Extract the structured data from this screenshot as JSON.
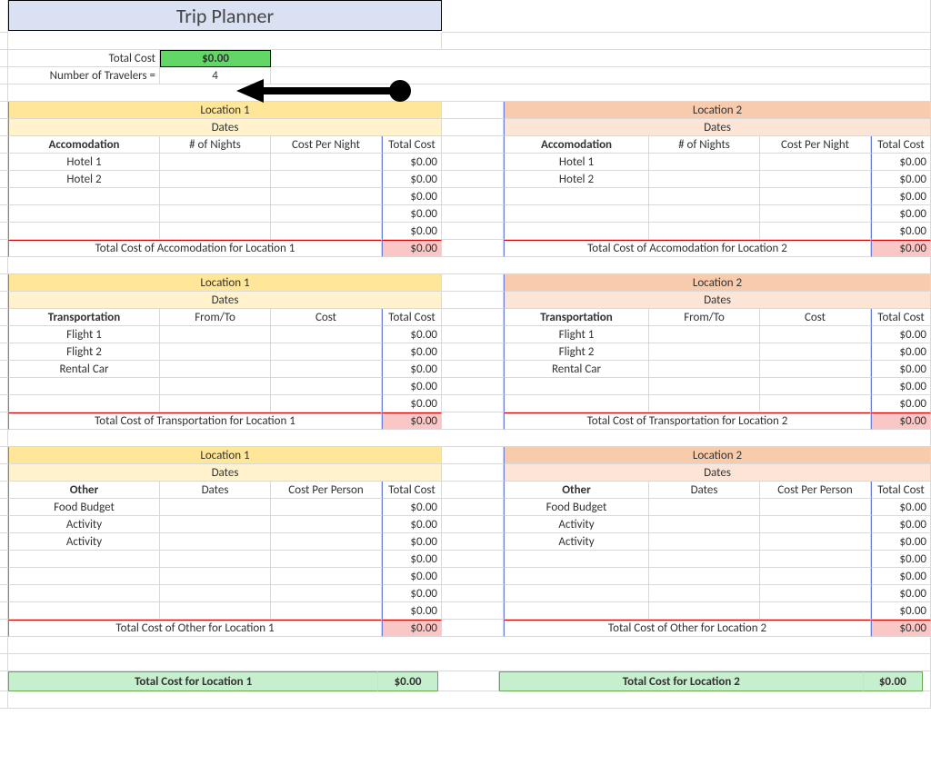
{
  "title": "Trip Planner",
  "summary": {
    "totalCostLabel": "Total Cost",
    "totalCostValue": "$0.00",
    "travelersLabel": "Number of Travelers  =",
    "travelersValue": "4"
  },
  "sections": {
    "accom": {
      "left": {
        "locHeader": "Location 1",
        "datesHeader": "Dates",
        "colA": "Accomodation",
        "colB": "# of Nights",
        "colC": "Cost Per Night",
        "colD": "Total Cost",
        "rows": [
          "Hotel 1",
          "Hotel 2",
          "",
          "",
          ""
        ],
        "vals": [
          "$0.00",
          "$0.00",
          "$0.00",
          "$0.00",
          "$0.00"
        ],
        "sumLabel": "Total Cost of Accomodation for Location 1",
        "sumVal": "$0.00"
      },
      "right": {
        "locHeader": "Location 2",
        "datesHeader": "Dates",
        "colA": "Accomodation",
        "colB": "# of Nights",
        "colC": "Cost Per Night",
        "colD": "Total Cost",
        "rows": [
          "Hotel 1",
          "Hotel 2",
          "",
          "",
          ""
        ],
        "vals": [
          "$0.00",
          "$0.00",
          "$0.00",
          "$0.00",
          "$0.00"
        ],
        "sumLabel": "Total Cost of Accomodation for Location 2",
        "sumVal": "$0.00"
      }
    },
    "transport": {
      "left": {
        "locHeader": "Location 1",
        "datesHeader": "Dates",
        "colA": "Transportation",
        "colB": "From/To",
        "colC": "Cost",
        "colD": "Total Cost",
        "rows": [
          "Flight 1",
          "Flight 2",
          "Rental Car",
          "",
          ""
        ],
        "vals": [
          "$0.00",
          "$0.00",
          "$0.00",
          "$0.00",
          "$0.00"
        ],
        "sumLabel": "Total Cost of Transportation for Location 1",
        "sumVal": "$0.00"
      },
      "right": {
        "locHeader": "Location 2",
        "datesHeader": "Dates",
        "colA": "Transportation",
        "colB": "From/To",
        "colC": "Cost",
        "colD": "Total Cost",
        "rows": [
          "Flight 1",
          "Flight 2",
          "Rental Car",
          "",
          ""
        ],
        "vals": [
          "$0.00",
          "$0.00",
          "$0.00",
          "$0.00",
          "$0.00"
        ],
        "sumLabel": "Total Cost of Transportation for Location 2",
        "sumVal": "$0.00"
      }
    },
    "other": {
      "left": {
        "locHeader": "Location 1",
        "datesHeader": "Dates",
        "colA": "Other",
        "colB": "Dates",
        "colC": "Cost Per Person",
        "colD": "Total Cost",
        "rows": [
          "Food Budget",
          "Activity",
          "Activity",
          "",
          "",
          "",
          ""
        ],
        "vals": [
          "$0.00",
          "$0.00",
          "$0.00",
          "$0.00",
          "$0.00",
          "$0.00",
          "$0.00"
        ],
        "sumLabel": "Total Cost of Other for Location 1",
        "sumVal": "$0.00"
      },
      "right": {
        "locHeader": "Location 2",
        "datesHeader": "Dates",
        "colA": "Other",
        "colB": "Dates",
        "colC": "Cost Per Person",
        "colD": "Total Cost",
        "rows": [
          "Food Budget",
          "Activity",
          "Activity",
          "",
          "",
          "",
          ""
        ],
        "vals": [
          "$0.00",
          "$0.00",
          "$0.00",
          "$0.00",
          "$0.00",
          "$0.00",
          "$0.00"
        ],
        "sumLabel": "Total Cost of Other for Location 2",
        "sumVal": "$0.00"
      }
    }
  },
  "locTotals": {
    "leftLabel": "Total Cost for Location 1",
    "leftVal": "$0.00",
    "rightLabel": "Total Cost for Location 2",
    "rightVal": "$0.00"
  }
}
